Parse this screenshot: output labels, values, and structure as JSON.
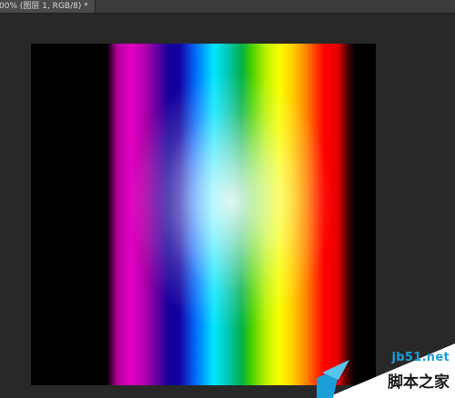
{
  "document_tab": {
    "title": "00% (图层 1, RGB/8) *",
    "close_glyph": "×"
  },
  "canvas": {
    "background": "#000000",
    "content": "rainbow spectrum gradient with radial white glow"
  },
  "watermark": {
    "url": "jb51.net",
    "name": "脚本之家",
    "accent": "#1a9fd8"
  }
}
